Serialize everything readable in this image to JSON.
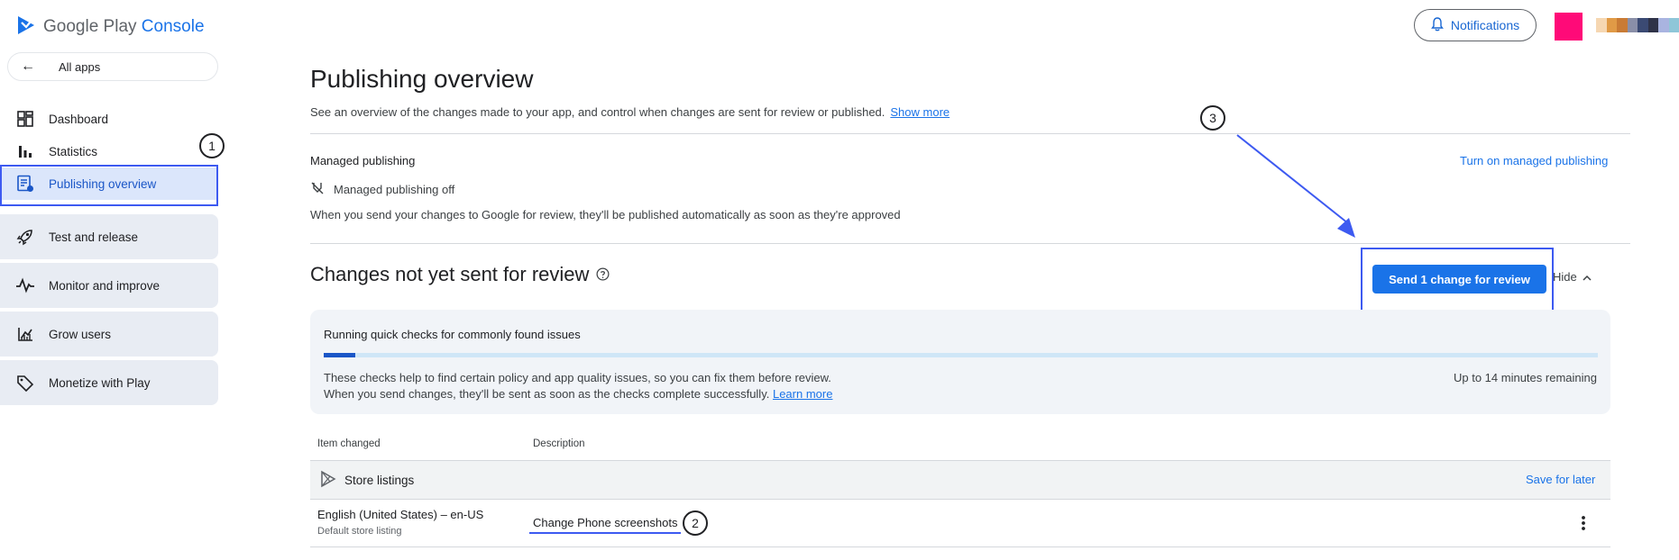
{
  "app": {
    "logo_google_play": "Google Play",
    "logo_console": "Console"
  },
  "header": {
    "notifications_label": "Notifications",
    "avatar_color": "#ff0a78",
    "account_chip_colors": [
      "#f6d7b2",
      "#e09a46",
      "#c97b35",
      "#8a8fa8",
      "#3b4a73",
      "#2f3348",
      "#a9b4e0",
      "#8fc6d8"
    ]
  },
  "sidebar": {
    "all_apps": "All apps",
    "items": [
      {
        "label": "Dashboard",
        "icon": "dashboard-icon"
      },
      {
        "label": "Statistics",
        "icon": "bar-chart-icon"
      },
      {
        "label": "Publishing overview",
        "icon": "publishing-icon",
        "active": true
      }
    ],
    "cards": [
      {
        "label": "Test and release",
        "icon": "rocket-icon"
      },
      {
        "label": "Monitor and improve",
        "icon": "pulse-icon"
      },
      {
        "label": "Grow users",
        "icon": "grow-users-icon"
      },
      {
        "label": "Monetize with Play",
        "icon": "tag-icon"
      }
    ]
  },
  "main": {
    "title": "Publishing overview",
    "subtitle": "See an overview of the changes made to your app, and control when changes are sent for review or published.",
    "show_more": "Show more",
    "managed": {
      "heading": "Managed publishing",
      "status": "Managed publishing off",
      "description": "When you send your changes to Google for review, they'll be published automatically as soon as they're approved",
      "turn_on": "Turn on managed publishing"
    },
    "changes": {
      "title": "Changes not yet sent for review",
      "send_button": "Send 1 change for review",
      "hide": "Hide",
      "checks": {
        "heading": "Running quick checks for commonly found issues",
        "progress_fraction": 0.025,
        "line1": "These checks help to find certain policy and app quality issues, so you can fix them before review.",
        "line2": "When you send changes, they'll be sent as soon as the checks complete successfully.",
        "learn_more": "Learn more",
        "remaining": "Up to 14 minutes remaining"
      },
      "table": {
        "col_item": "Item changed",
        "col_description": "Description",
        "group": {
          "label": "Store listings",
          "action": "Save for later"
        },
        "rows": [
          {
            "item": "English (United States) – en-US",
            "item_sub": "Default store listing",
            "description": "Change Phone screenshots"
          }
        ]
      }
    }
  },
  "annotations": {
    "one": "1",
    "two": "2",
    "three": "3",
    "color": "#3d5af1"
  }
}
